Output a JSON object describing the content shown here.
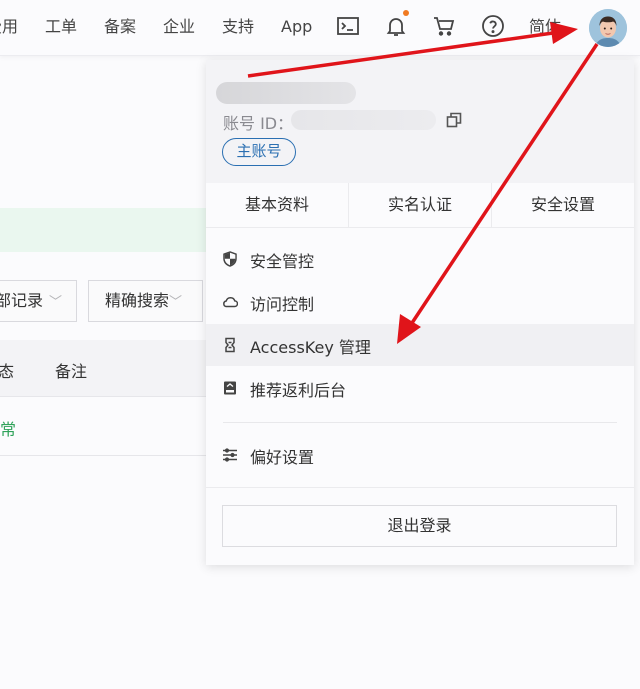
{
  "topbar": {
    "nav_items": [
      "费用",
      "工单",
      "备案",
      "企业",
      "支持",
      "App"
    ],
    "icons": [
      "terminal-icon",
      "bell-icon",
      "cart-icon",
      "help-icon"
    ],
    "notification_dot_color": "#f07a22",
    "language": "简体",
    "avatar": "user-avatar"
  },
  "background": {
    "filter_select_1": "部记录",
    "filter_select_2": "精确搜索",
    "table_headers": [
      "态",
      "备注"
    ],
    "row_status": "常",
    "status_color": "#2fa25a"
  },
  "account_menu": {
    "account_id_label": "账号 ID：",
    "account_badge": "主账号",
    "badge_color": "#2a6fb2",
    "tabs": [
      "基本资料",
      "实名认证",
      "安全设置"
    ],
    "items": [
      {
        "icon": "shield-icon",
        "label": "安全管控"
      },
      {
        "icon": "cloud-icon",
        "label": "访问控制"
      },
      {
        "icon": "key-icon",
        "label": "AccessKey 管理",
        "highlighted": true
      },
      {
        "icon": "referral-icon",
        "label": "推荐返利后台"
      },
      {
        "icon": "sliders-icon",
        "label": "偏好设置"
      }
    ],
    "logout": "退出登录"
  },
  "annotations": {
    "arrow_color": "#e0141a"
  }
}
